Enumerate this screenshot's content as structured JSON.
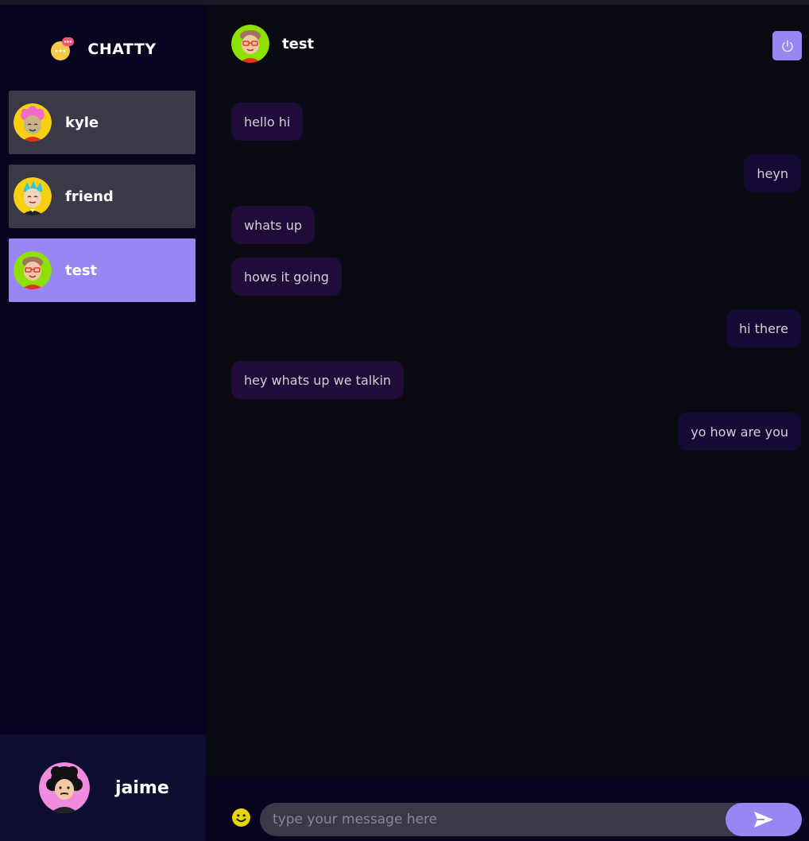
{
  "app": {
    "brand_title": "CHATTY",
    "accent_color": "#9a86f3",
    "logo_icon": "chat-bubbles-icon"
  },
  "contacts": [
    {
      "name": "kyle",
      "avatar": "avatar-pink-hair-icon",
      "selected": false
    },
    {
      "name": "friend",
      "avatar": "avatar-blue-hair-icon",
      "selected": false
    },
    {
      "name": "test",
      "avatar": "avatar-glasses-icon",
      "selected": true
    }
  ],
  "current_user": {
    "name": "jaime",
    "avatar": "avatar-curly-hair-icon"
  },
  "chat": {
    "contact_name": "test",
    "logout_icon": "power-icon",
    "messages": [
      {
        "text": "hello hi",
        "direction": "received"
      },
      {
        "text": "heyn",
        "direction": "sent"
      },
      {
        "text": "whats up",
        "direction": "received"
      },
      {
        "text": "hows it going",
        "direction": "received"
      },
      {
        "text": "hi there",
        "direction": "sent"
      },
      {
        "text": "hey whats up we talkin",
        "direction": "received"
      },
      {
        "text": "yo how are you",
        "direction": "sent"
      }
    ]
  },
  "composer": {
    "placeholder": "type your message here",
    "value": "",
    "emoji_icon": "smiley-icon",
    "send_icon": "send-arrow-icon"
  }
}
